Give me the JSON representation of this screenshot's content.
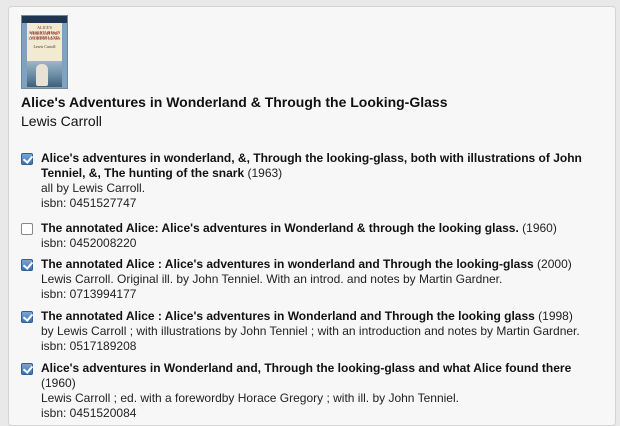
{
  "book": {
    "cover_icon": "book-cover-image",
    "cover_text": [
      "ALICE'S ADVENTURES IN WONDERLAND",
      "THROUGH THE LOOKING GLASS",
      "Lewis Carroll"
    ],
    "title": "Alice's Adventures in Wonderland & Through the Looking-Glass",
    "author": "Lewis Carroll"
  },
  "editions": [
    {
      "checked": true,
      "title_line1": "Alice's adventures in wonderland, &, Through the looking-glass, both with illustrations of John",
      "title_line2": "Tenniel, &, The hunting of the snark",
      "year": "(1963)",
      "credit": "all by Lewis Carroll.",
      "isbn": "isbn: 0451527747"
    },
    {
      "checked": false,
      "title": "The annotated Alice: Alice's adventures in Wonderland & through the looking glass.",
      "year": "(1960)",
      "isbn": "isbn: 0452008220"
    },
    {
      "checked": true,
      "title": "The annotated Alice : Alice's adventures in wonderland and Through the looking-glass",
      "year": "(2000)",
      "credit": "Lewis Carroll. Original ill. by John Tenniel. With an introd. and notes by Martin Gardner.",
      "isbn": "isbn: 0713994177"
    },
    {
      "checked": true,
      "title": "The annotated Alice : Alice's adventures in Wonderland and Through the looking glass",
      "year": "(1998)",
      "credit": "by Lewis Carroll ; with illustrations by John Tenniel ; with an introduction and notes by Martin Gardner.",
      "isbn": "isbn: 0517189208"
    },
    {
      "checked": true,
      "title": "Alice's adventures in Wonderland and, Through the looking-glass and what Alice found there",
      "year": "(1960)",
      "credit": "Lewis Carroll ; ed. with a forewordby Horace Gregory ; with ill. by John Tenniel.",
      "isbn": "isbn: 0451520084"
    }
  ],
  "colors": {
    "checkbox_checked": "#3a73b4",
    "panel_bg": "#f7f7f7",
    "page_bg": "#e9e9e9"
  }
}
